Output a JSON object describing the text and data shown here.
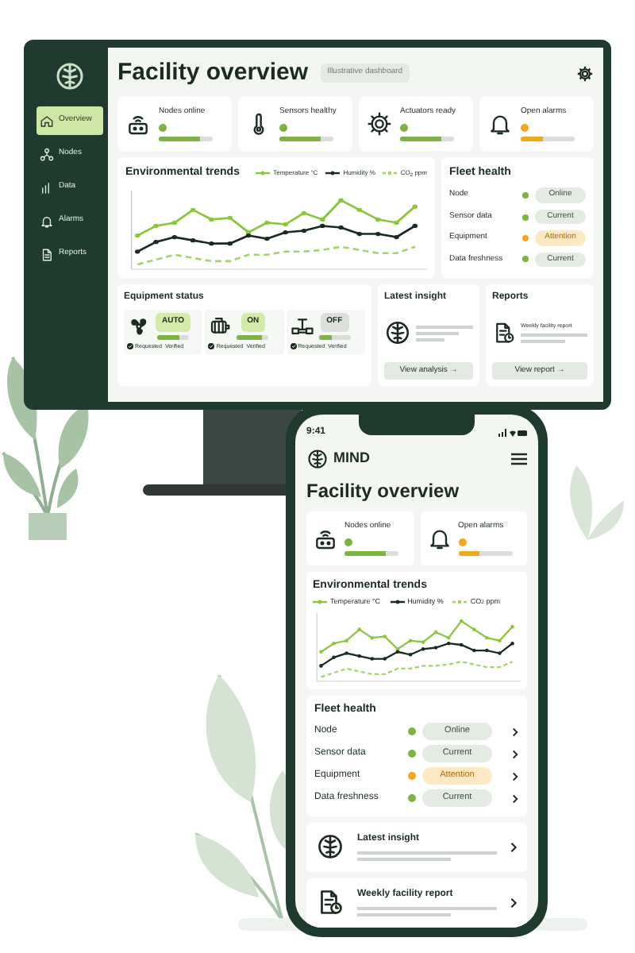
{
  "desktop": {
    "sidebar": {
      "items": [
        {
          "label": "Overview",
          "kind": "home",
          "selected": true
        },
        {
          "label": "Nodes",
          "kind": "network",
          "selected": false
        },
        {
          "label": "Data",
          "kind": "bars",
          "selected": false
        },
        {
          "label": "Alarms",
          "kind": "bell",
          "selected": false
        },
        {
          "label": "Reports",
          "kind": "document",
          "selected": false
        }
      ]
    },
    "title": "Facility overview",
    "badge": "Illustrative dashboard",
    "kpis": [
      {
        "label": "Nodes online",
        "kind": "router",
        "color": "#7cb342",
        "level": 0.75
      },
      {
        "label": "Sensors healthy",
        "kind": "thermometer",
        "color": "#7cb342",
        "level": 0.75
      },
      {
        "label": "Actuators ready",
        "kind": "gear",
        "color": "#7cb342",
        "level": 0.75
      },
      {
        "label": "Open alarms",
        "kind": "bell",
        "color": "#f2a81d",
        "level": 0.4
      }
    ],
    "trends": {
      "title": "Environmental trends",
      "legend": [
        {
          "label": "Temperature °C",
          "kind": "solid",
          "color": "#8cc63f"
        },
        {
          "label": "Humidity %",
          "kind": "solid",
          "color": "#1b2b22"
        },
        {
          "label": "CO$_{2}$ ppm",
          "kind": "dashed",
          "color": "#a5d46a"
        }
      ]
    },
    "fleet": {
      "title": "Fleet health",
      "rows": [
        {
          "label": "Node",
          "status": "Online",
          "color": "#7cb342",
          "warning": false
        },
        {
          "label": "Sensor data",
          "status": "Current",
          "color": "#7cb342",
          "warning": false
        },
        {
          "label": "Equipment",
          "status": "Attention",
          "color": "#f2a81d",
          "warning": true
        },
        {
          "label": "Data freshness",
          "status": "Current",
          "color": "#7cb342",
          "warning": false
        }
      ]
    },
    "equipment": {
      "title": "Equipment status",
      "items": [
        {
          "kind": "fan",
          "mode": "AUTO",
          "on": true,
          "level": 0.7,
          "requested": "Requested",
          "verified": "Verified"
        },
        {
          "kind": "motor",
          "mode": "ON",
          "on": true,
          "level": 0.8,
          "requested": "Requested",
          "verified": "Verified"
        },
        {
          "kind": "valve",
          "mode": "OFF",
          "on": false,
          "level": 0.4,
          "requested": "Requested",
          "verified": "Verified"
        }
      ]
    },
    "insight": {
      "title": "Latest insight",
      "button": "View analysis →"
    },
    "reports": {
      "title": "Reports",
      "subtitle": "Weekly facility report",
      "button": "View report →"
    }
  },
  "phone": {
    "time": "9:41",
    "brand": "MIND",
    "title": "Facility overview",
    "kpis": [
      {
        "label": "Nodes online",
        "kind": "router",
        "color": "#7cb342",
        "level": 0.75
      },
      {
        "label": "Open alarms",
        "kind": "bell",
        "color": "#f2a81d",
        "level": 0.4
      }
    ],
    "trends": {
      "title": "Environmental trends",
      "legend": [
        {
          "label": "Temperature °C",
          "kind": "solid",
          "color": "#8cc63f"
        },
        {
          "label": "Humidity %",
          "kind": "solid",
          "color": "#1b2b22"
        },
        {
          "label": "CO$_{2}$ ppm",
          "kind": "dashed",
          "color": "#a5d46a"
        }
      ]
    },
    "fleet": {
      "title": "Fleet health",
      "rows": [
        {
          "label": "Node",
          "status": "Online",
          "color": "#7cb342",
          "warning": false
        },
        {
          "label": "Sensor data",
          "status": "Current",
          "color": "#7cb342",
          "warning": false
        },
        {
          "label": "Equipment",
          "status": "Attention",
          "color": "#f2a81d",
          "warning": true
        },
        {
          "label": "Data freshness",
          "status": "Current",
          "color": "#7cb342",
          "warning": false
        }
      ]
    },
    "cards": [
      {
        "title": "Latest insight",
        "kind": "brain"
      },
      {
        "title": "Weekly facility report",
        "kind": "report"
      }
    ]
  }
}
